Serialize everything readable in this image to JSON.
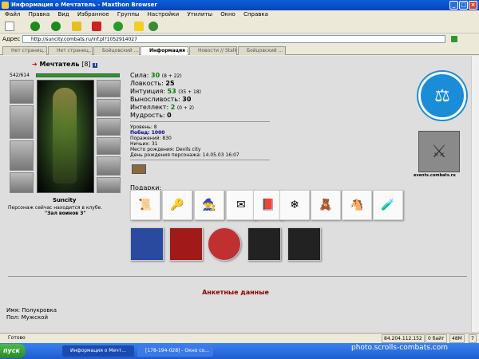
{
  "window": {
    "title": "Информация о Мечтатель - Maxthon Browser"
  },
  "menu": [
    "Файл",
    "Правка",
    "Вид",
    "Избранное",
    "Группы",
    "Настройки",
    "Утилиты",
    "Окно",
    "Справка"
  ],
  "address": {
    "label": "Адрес",
    "url": "http://suncity.combats.ru/inf.pl?1052914027"
  },
  "tabs": [
    "Нет страниц...",
    "Нет страниц...",
    "Бойцовский ...",
    "Информация ...",
    "Новости // Stalk...",
    "Бойцовский ..."
  ],
  "character": {
    "name": "Мечтатель",
    "level": "[8]",
    "hp": "542/614",
    "portrait_label": "Suncity",
    "location_line1": "Персонаж сейчас находится в клубе.",
    "location_line2": "\"Зал воинов 3\""
  },
  "stats": [
    {
      "label": "Сила:",
      "value": "30",
      "extra": "(8 + 22)",
      "green": true
    },
    {
      "label": "Ловкость:",
      "value": "25",
      "extra": "",
      "green": false
    },
    {
      "label": "Интуиция:",
      "value": "53",
      "extra": "(35 + 18)",
      "green": true
    },
    {
      "label": "Выносливость:",
      "value": "30",
      "extra": "",
      "green": false
    },
    {
      "label": "Интеллект:",
      "value": "2",
      "extra": "(0 + 2)",
      "green": true
    },
    {
      "label": "Мудрость:",
      "value": "0",
      "extra": "",
      "green": false
    }
  ],
  "info": [
    "Уровень: 8",
    "Побед: 1000",
    "Поражений: 830",
    "Ничьих: 31",
    "Место рождения: Devils city",
    "День рождения персонажа: 14.05.03 16:07"
  ],
  "gifts_label": "Подарки:",
  "anketa_title": "Анкетные данные",
  "profile": {
    "name": "Имя: Полукровка",
    "sex": "Пол: Мужской"
  },
  "emblem2_label": "events.combats.ru",
  "status": {
    "ready": "Готово",
    "ip": "84.204.112.152",
    "bytes": "0 байт",
    "mem": "48M",
    "num": "7"
  },
  "taskbar": {
    "start": "пуск",
    "task1": "Информация о Мечт...",
    "task2": "[178-194-028] - Окно со..."
  },
  "watermark": "photo.scrolls-combats.com"
}
